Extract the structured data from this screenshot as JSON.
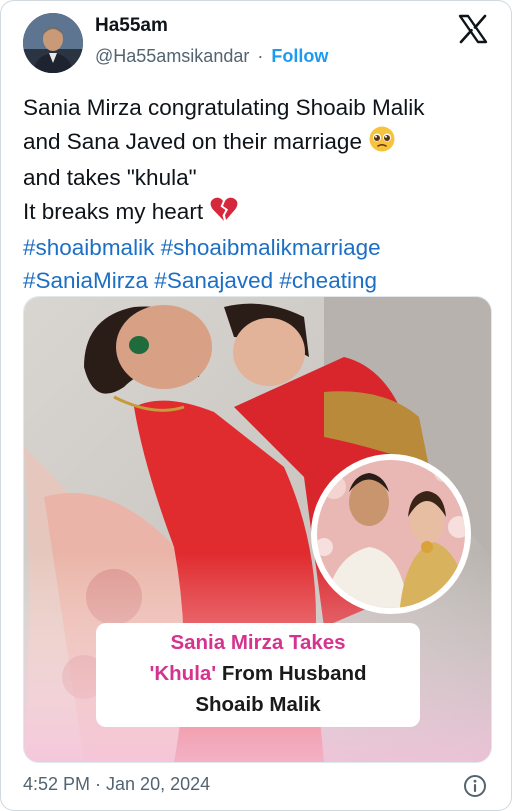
{
  "author": {
    "display_name": "Ha55am",
    "handle": "@Ha55amsikandar",
    "separator": "·",
    "follow_label": "Follow",
    "avatar_icon": "profile-photo"
  },
  "platform": {
    "logo_icon": "x-logo-icon"
  },
  "tweet": {
    "line1": "Sania Mirza congratulating Shoaib Malik",
    "line2": "and Sana Javed on their marriage",
    "line2_emoji": "pleading-face-emoji",
    "line3": "and takes \"khula\"",
    "line4": "It breaks my heart",
    "line4_emoji": "broken-heart-emoji",
    "hashtags_line1": "#shoaibmalik #shoaibmalikmarriage",
    "hashtags_line2": "#SaniaMirza #Sanajaved #cheating"
  },
  "media": {
    "headline_line1": "Sania Mirza Takes",
    "headline_line2_pink": "'Khula'",
    "headline_line2_dark": " From Husband",
    "headline_line3": "Shoaib Malik"
  },
  "footer": {
    "timestamp": "4:52 PM · Jan 20, 2024",
    "info_icon": "info-icon"
  },
  "colors": {
    "link": "#1d6fc4",
    "follow": "#1d9bf0",
    "headline_pink": "#d6338f",
    "muted": "#536471"
  }
}
